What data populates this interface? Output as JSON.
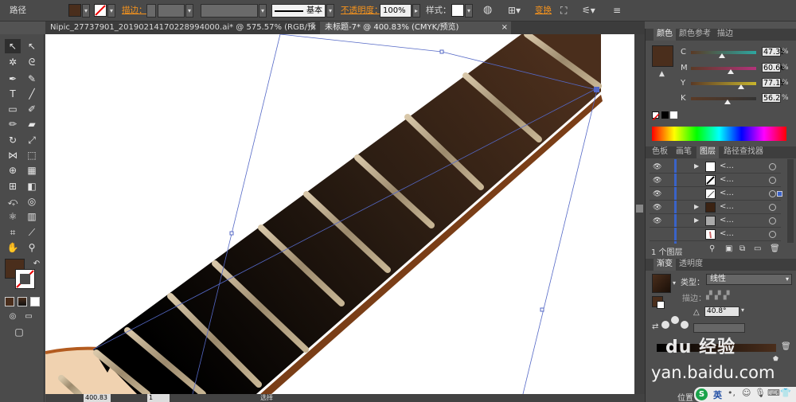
{
  "control_bar": {
    "object_type": "路径",
    "stroke_label": "描边：",
    "stroke_profile": "基本",
    "opacity_label": "不透明度：",
    "opacity_value": "100%",
    "style_label": "样式：",
    "transform_label": "变换"
  },
  "tabs": [
    {
      "label": "Nipic_27737901_20190214170228994000.ai* @ 575.57% (RGB/预览)",
      "active": false
    },
    {
      "label": "未标题-7* @ 400.83% (CMYK/预览)",
      "active": true
    }
  ],
  "color_panel": {
    "tabs": [
      "颜色",
      "颜色参考",
      "描边"
    ],
    "fill_color": "#4a2e1c",
    "channels": [
      {
        "label": "C",
        "value": "47.35",
        "unit": "%",
        "level": 0.4735,
        "color": "#2ea6a0"
      },
      {
        "label": "M",
        "value": "60.66",
        "unit": "%",
        "level": 0.6066,
        "color": "#b3337a"
      },
      {
        "label": "Y",
        "value": "77.19",
        "unit": "%",
        "level": 0.7719,
        "color": "#c8b52d"
      },
      {
        "label": "K",
        "value": "56.2",
        "unit": "%",
        "level": 0.562,
        "color": "#333333"
      }
    ]
  },
  "layers_panel": {
    "tabs": [
      "色板",
      "画笔",
      "图层",
      "路径查找器"
    ],
    "rows": [
      {
        "name": "<...",
        "expanded": true
      },
      {
        "name": "<...",
        "expanded": false
      },
      {
        "name": "<...",
        "expanded": false
      },
      {
        "name": "<...",
        "expanded": true
      },
      {
        "name": "<...",
        "expanded": true
      },
      {
        "name": "<...",
        "expanded": false
      }
    ],
    "footer": "1 个图层"
  },
  "gradient_panel": {
    "tabs": [
      "渐变",
      "透明度"
    ],
    "type_label": "类型：",
    "type_value": "线性",
    "stroke_label": "描边：",
    "angle_value": "40.8°",
    "location_label": "位置"
  },
  "status_bar": {
    "zoom": "400.83",
    "artboard": "1",
    "mode": "选择"
  },
  "watermark": {
    "brand": "du 经验",
    "url": "jingyan.baidu.com",
    "url_visible": "yan.baidu.com"
  },
  "ime": {
    "lang": "英"
  },
  "colors": {
    "accent_orange": "#f7941d",
    "fretboard_dark": "#0d0d0d",
    "fretboard_brown": "#4a2e1c",
    "fret_silver": "#c9b79a",
    "body_tan": "#f0d2b0"
  }
}
